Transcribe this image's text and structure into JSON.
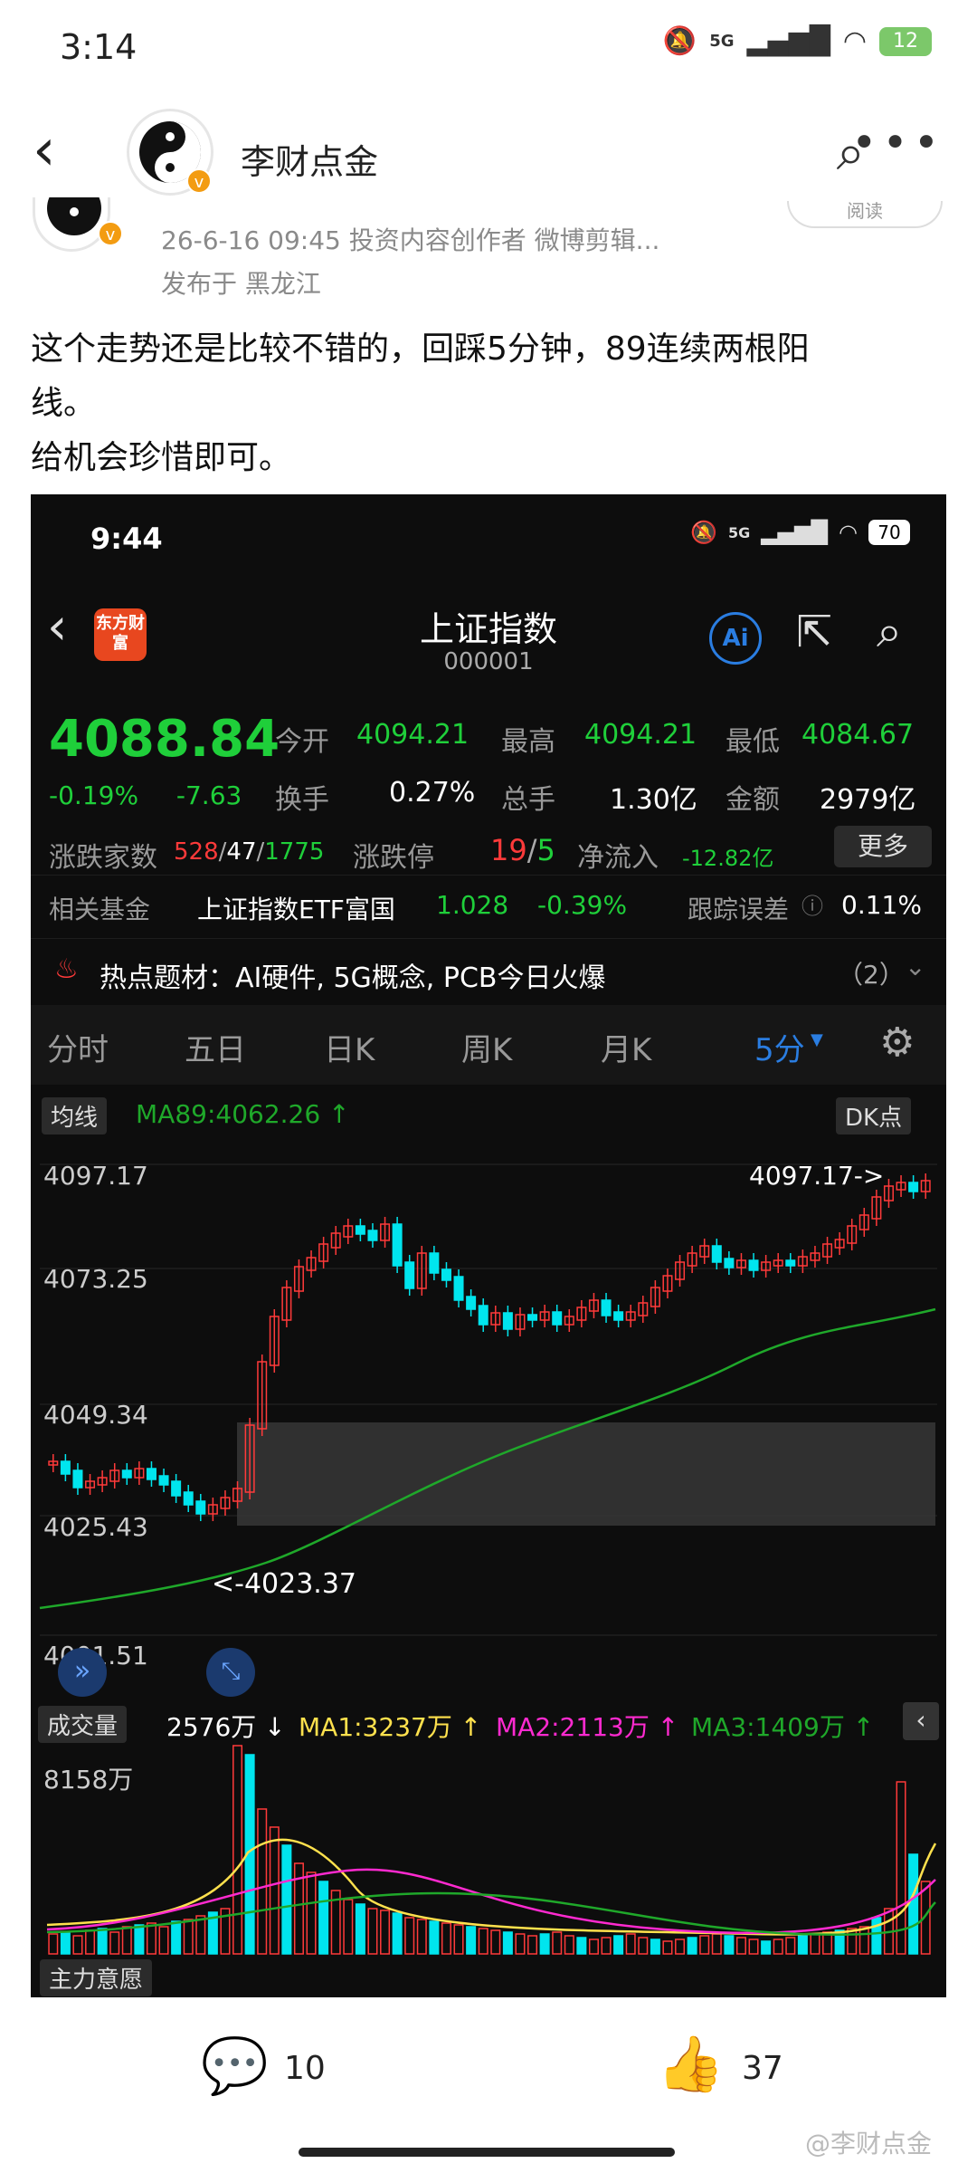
{
  "status_bar": {
    "time": "3:14",
    "net": "5G",
    "battery": "12"
  },
  "header": {
    "author": "李财点金"
  },
  "post": {
    "meta": "26-6-16 09:45  投资内容创作者 微博剪辑...",
    "location": "发布于 黑龙江",
    "read_label": "阅读",
    "text_line1": "这个走势还是比较不错的，回踩5分钟，89连续两根阳",
    "text_line2": "线。",
    "text_line3": "给机会珍惜即可。"
  },
  "screenshot": {
    "status": {
      "time": "9:44",
      "battery": "70",
      "net": "5G"
    },
    "nav": {
      "logo": "东方财富",
      "title": "上证指数",
      "code": "000001",
      "ai_label": "Ai"
    },
    "quote": {
      "price": "4088.84",
      "pct": "-0.19%",
      "chg": "-7.63",
      "open_label": "今开",
      "open": "4094.21",
      "high_label": "最高",
      "high": "4094.21",
      "low_label": "最低",
      "low": "4084.67",
      "turnover_label": "换手",
      "turnover": "0.27%",
      "volume_label": "总手",
      "volume": "1.30亿",
      "amount_label": "金额",
      "amount": "2979亿",
      "breadth_label": "涨跌家数",
      "up": "528",
      "flat": "47",
      "down": "1775",
      "limit_label": "涨跌停",
      "limit_up": "19",
      "limit_down": "5",
      "flow_label": "净流入",
      "flow": "-12.82亿",
      "more": "更多"
    },
    "fund": {
      "label": "相关基金",
      "name": "上证指数ETF富国",
      "price": "1.028",
      "pct": "-0.39%",
      "err_label": "跟踪误差",
      "err": "0.11%"
    },
    "topic": {
      "label": "热点题材：",
      "text": "AI硬件, 5G概念, PCB今日火爆",
      "count": "（2）"
    },
    "tabs": [
      "分时",
      "五日",
      "日K",
      "周K",
      "月K",
      "5分"
    ],
    "indicator": {
      "chip": "均线",
      "ma89": "MA89:4062.26 ↑",
      "dk": "DK点"
    },
    "axis": {
      "y1": "4097.17",
      "y2": "4073.25",
      "y3": "4049.34",
      "y4": "4025.43",
      "y5": "4001.51"
    },
    "annotations": {
      "high": "4097.17->",
      "low": "<-4023.37"
    },
    "volume": {
      "chip": "成交量",
      "current": "2576万 ↓",
      "ma1": "MA1:3237万 ↑",
      "ma2": "MA2:2113万 ↑",
      "ma3": "MA3:1409万 ↑",
      "ymax": "8158万"
    },
    "bottom_chip": "主力意愿",
    "colors": {
      "up": "#ff3a3a",
      "down": "#00e5ee",
      "ma89": "#1fa82a",
      "ma1": "#ffe14d",
      "ma2": "#ff2ad0",
      "ma3": "#1fa82a"
    }
  },
  "actions": {
    "comments": "10",
    "likes": "37"
  },
  "watermark": "@李财点金"
}
